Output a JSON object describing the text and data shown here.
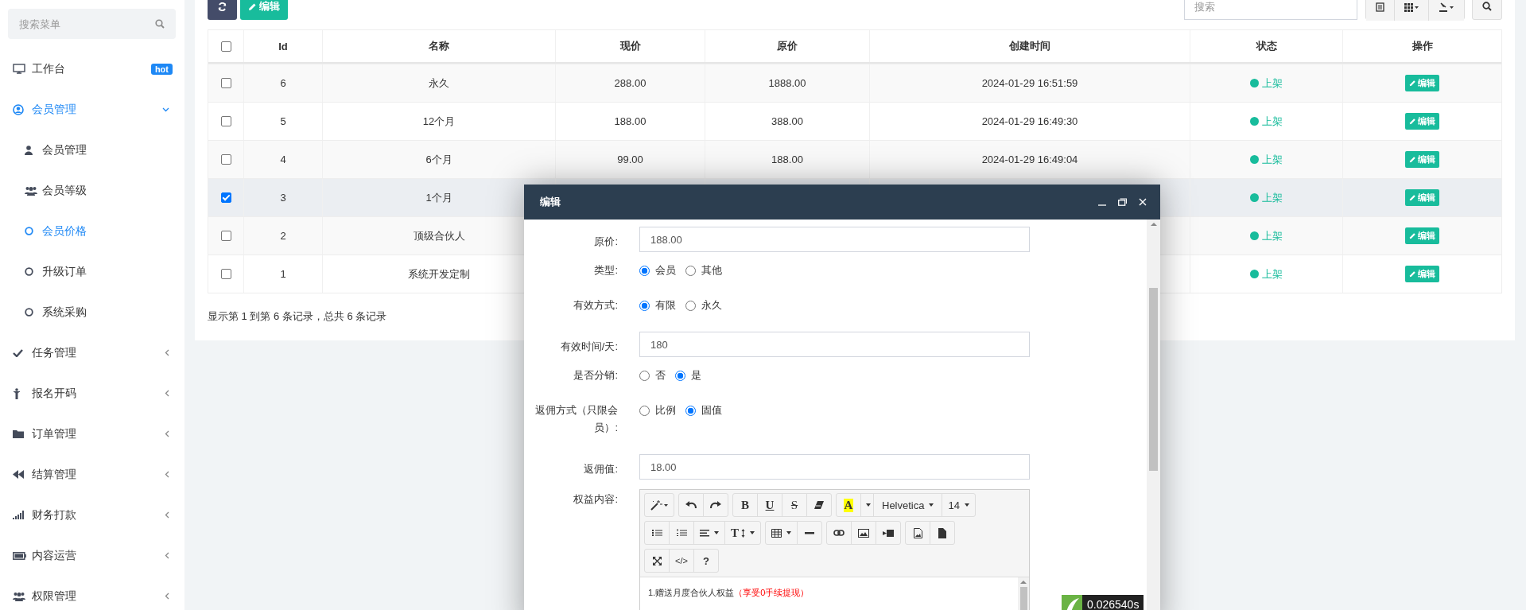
{
  "sidebar": {
    "search": {
      "placeholder": "搜索菜单"
    },
    "items": [
      {
        "label": "工作台",
        "badge": "hot",
        "selected": false
      },
      {
        "label": "会员管理",
        "selected": true,
        "expanded": true,
        "children": [
          {
            "label": "会员管理",
            "selected": false
          },
          {
            "label": "会员等级",
            "selected": false
          },
          {
            "label": "会员价格",
            "selected": true
          },
          {
            "label": "升级订单",
            "selected": false
          },
          {
            "label": "系统采购",
            "selected": false
          }
        ]
      },
      {
        "label": "任务管理",
        "selected": false,
        "expanded": false
      },
      {
        "label": "报名开码",
        "selected": false,
        "expanded": false
      },
      {
        "label": "订单管理",
        "selected": false,
        "expanded": false
      },
      {
        "label": "结算管理",
        "selected": false,
        "expanded": false
      },
      {
        "label": "财务打款",
        "selected": false,
        "expanded": false
      },
      {
        "label": "内容运营",
        "selected": false,
        "expanded": false
      },
      {
        "label": "权限管理",
        "selected": false,
        "expanded": false
      }
    ]
  },
  "toolbar": {
    "edit_button": "编辑",
    "search": {
      "placeholder": "搜索"
    }
  },
  "table": {
    "columns": [
      "Id",
      "名称",
      "现价",
      "原价",
      "创建时间",
      "状态",
      "操作"
    ],
    "all_checked": false,
    "rows": [
      {
        "checked": false,
        "cells": [
          "6",
          "永久",
          "288.00",
          "1888.00",
          "2024-01-29 16:51:59"
        ],
        "status": "上架",
        "action": "编辑"
      },
      {
        "checked": false,
        "cells": [
          "5",
          "12个月",
          "188.00",
          "388.00",
          "2024-01-29 16:49:30"
        ],
        "status": "上架",
        "action": "编辑"
      },
      {
        "checked": false,
        "cells": [
          "4",
          "6个月",
          "99.00",
          "188.00",
          "2024-01-29 16:49:04"
        ],
        "status": "上架",
        "action": "编辑"
      },
      {
        "checked": true,
        "cells": [
          "3",
          "1个月",
          "",
          "",
          ""
        ],
        "status": "上架",
        "action": "编辑"
      },
      {
        "checked": false,
        "cells": [
          "2",
          "顶级合伙人",
          "",
          "",
          ""
        ],
        "status": "上架",
        "action": "编辑"
      },
      {
        "checked": false,
        "cells": [
          "1",
          "系统开发定制",
          "",
          "",
          ""
        ],
        "status": "上架",
        "action": "编辑"
      }
    ],
    "footer": "显示第 1 到第 6 条记录，总共 6 条记录"
  },
  "dialog": {
    "title": "编辑",
    "fields": [
      {
        "kind": "text",
        "label": "原价:",
        "value": "188.00"
      },
      {
        "kind": "radio",
        "label": "类型:",
        "options": [
          {
            "label": "会员",
            "selected": true
          },
          {
            "label": "其他",
            "selected": false
          }
        ]
      },
      {
        "kind": "radio",
        "label": "有效方式:",
        "options": [
          {
            "label": "有限",
            "selected": true
          },
          {
            "label": "永久",
            "selected": false
          }
        ]
      },
      {
        "kind": "text",
        "label": "有效时间/天:",
        "value": "180"
      },
      {
        "kind": "radio",
        "label": "是否分销:",
        "options": [
          {
            "label": "否",
            "selected": false
          },
          {
            "label": "是",
            "selected": true
          }
        ]
      },
      {
        "kind": "radio",
        "label": "返佣方式（只限会员）:",
        "options": [
          {
            "label": "比例",
            "selected": false
          },
          {
            "label": "固值",
            "selected": true
          }
        ]
      },
      {
        "kind": "text",
        "label": "返佣值:",
        "value": "18.00"
      },
      {
        "kind": "editor",
        "label": "权益内容:",
        "font": "Helvetica",
        "size": "14",
        "glyphs": [
          "B",
          "U",
          "S",
          "A",
          "T",
          "</>",
          "?"
        ],
        "content": "1.赠送月度合伙人权益",
        "content_highlight": "（享受0手续提现）"
      }
    ]
  },
  "debug": {
    "time": "0.026540s"
  }
}
